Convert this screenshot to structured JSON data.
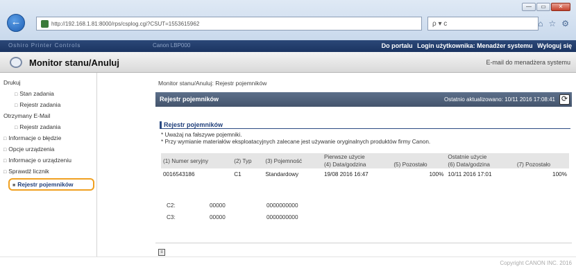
{
  "browser": {
    "url": "http://192.168.1.81:8000/rps/csplog.cgi?CSUT=1553615962",
    "search_placeholder": "ρ ▾ c",
    "window_buttons": [
      "—",
      "▭",
      "✕"
    ]
  },
  "topbar": {
    "left_blur": "Oshiro  Printer  Controls",
    "mid_blur": "Canon  LBP000",
    "links": [
      "Do portalu",
      "Login użytkownika: Menadżer systemu",
      "Wyloguj się"
    ]
  },
  "header": {
    "title": "Monitor stanu/Anuluj",
    "right_link": "E-mail do menadżera systemu"
  },
  "sidebar": {
    "items": [
      {
        "label": "Drukuj",
        "level": 0
      },
      {
        "label": "Stan zadania",
        "level": 1
      },
      {
        "label": "Rejestr zadania",
        "level": 1
      },
      {
        "label": "Otrzymany E-Mail",
        "level": 0
      },
      {
        "label": "Rejestr zadania",
        "level": 1
      },
      {
        "label": "Informacje o błędzie",
        "level": 2
      },
      {
        "label": "Opcje urządzenia",
        "level": 2
      },
      {
        "label": "Informacje o urządzeniu",
        "level": 2
      },
      {
        "label": "Sprawdź licznik",
        "level": 2
      }
    ],
    "selected": "Rejestr pojemników"
  },
  "main": {
    "breadcrumb": "Monitor stanu/Anuluj: Rejestr pojemników",
    "panel_title": "Rejestr pojemników",
    "last_updated": "Ostatnio aktualizowano: 10/11 2016 17:08:41",
    "section_title": "Rejestr pojemników",
    "notes": [
      "* Uważaj na fałszywe pojemniki.",
      "* Przy wymianie materiałów eksploatacyjnych zalecane jest używanie oryginalnych produktów firmy Canon."
    ],
    "table": {
      "group_first": "Pierwsze użycie",
      "group_last": "Ostatnie użycie",
      "headers": [
        "(1) Numer seryjny",
        "(2) Typ",
        "(3) Pojemność",
        "(4) Data/godzina",
        "(5) Pozostało",
        "(6) Data/godzina",
        "(7) Pozostało"
      ],
      "rows": [
        [
          "0016543186",
          "C1",
          "Standardowy",
          "19/08 2016 16:47",
          "100%",
          "10/11 2016 17:01",
          "100%"
        ]
      ]
    },
    "counters": [
      {
        "label": "C2:",
        "value1": "00000",
        "value2": "0000000000"
      },
      {
        "label": "C3:",
        "value1": "00000",
        "value2": "0000000000"
      }
    ],
    "page_button": "≡"
  },
  "footer": {
    "copyright": "Copyright CANON INC. 2016"
  }
}
